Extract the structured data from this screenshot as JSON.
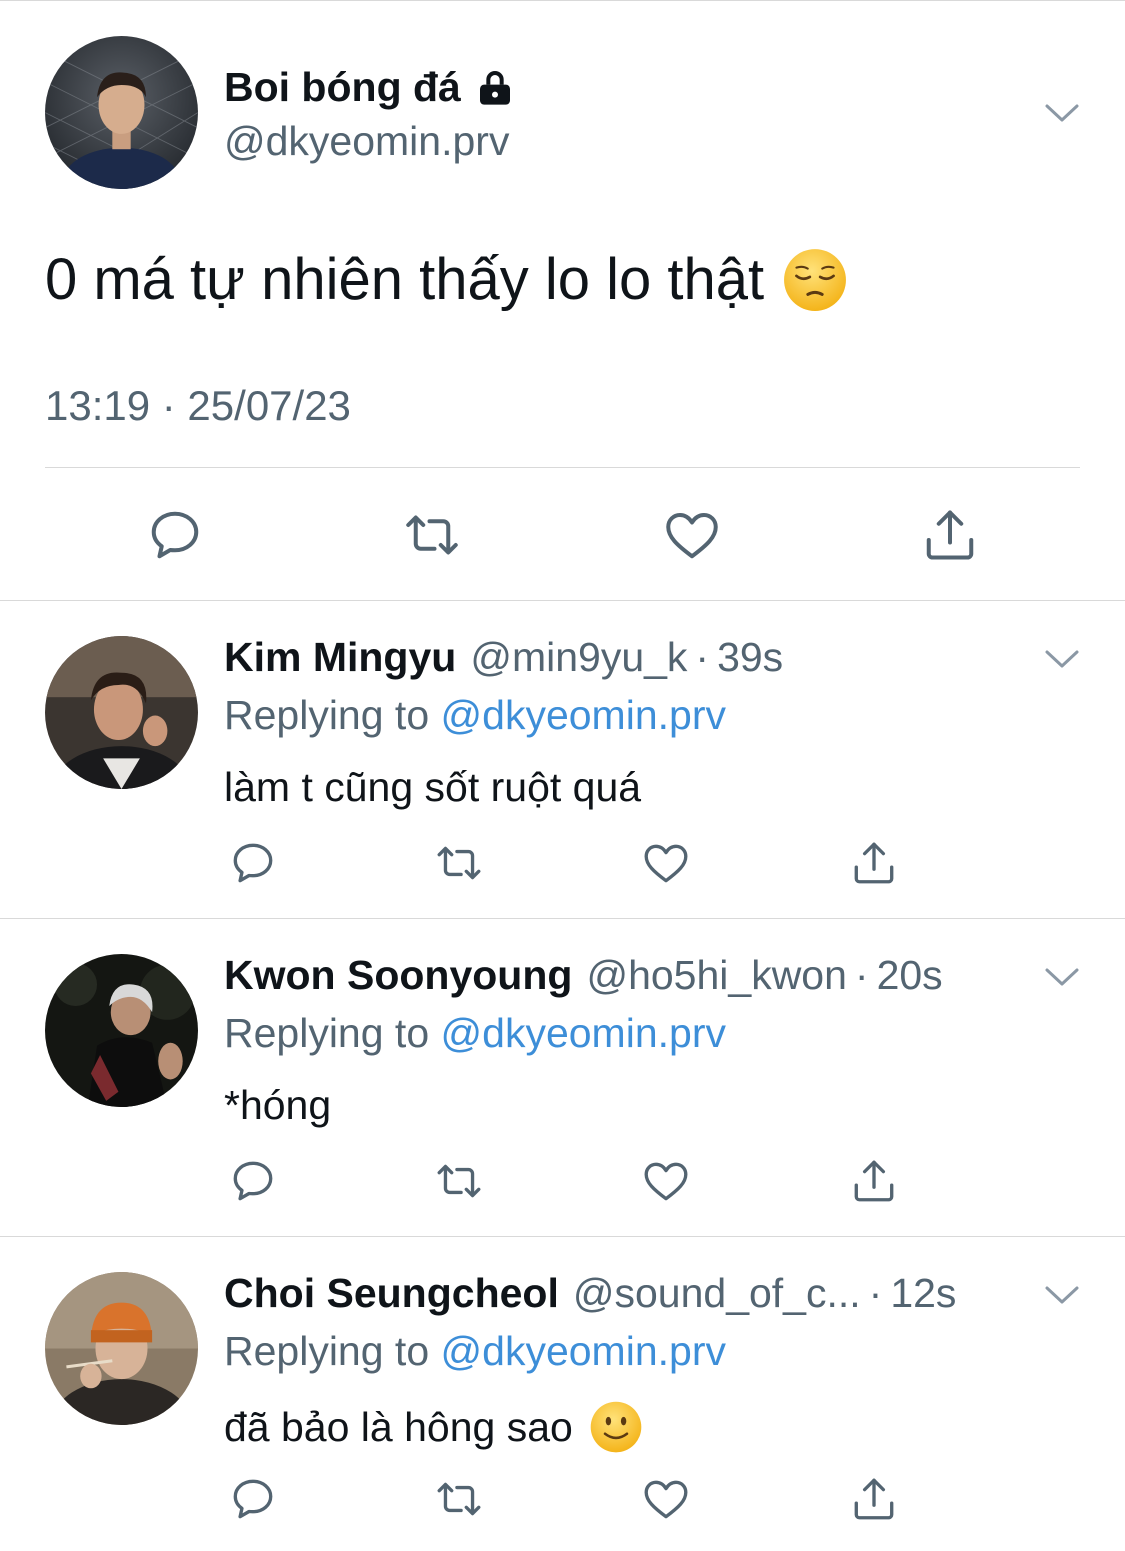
{
  "main": {
    "name": "Boi bóng đá",
    "handle": "@dkyeomin.prv",
    "text": "0 má tự nhiên thấy lo lo thật",
    "emoji": "pensive-face",
    "timestamp": "13:19 · 25/07/23"
  },
  "replying_label": "Replying to",
  "replies": [
    {
      "name": "Kim Mingyu",
      "handle": "@min9yu_k",
      "time": "39s",
      "mention": "@dkyeomin.prv",
      "text": "làm t cũng sốt ruột quá"
    },
    {
      "name": "Kwon Soonyoung",
      "handle": "@ho5hi_kwon",
      "time": "20s",
      "mention": "@dkyeomin.prv",
      "text": "*hóng"
    },
    {
      "name": "Choi Seungcheol",
      "handle": "@sound_of_c...",
      "time": "12s",
      "mention": "@dkyeomin.prv",
      "text": "đã bảo là hông sao",
      "emoji": "slightly-smiling-face"
    }
  ],
  "separator": "·",
  "colors": {
    "text": "#0f1419",
    "secondary": "#536471",
    "mention": "#3d8ed8",
    "icon": "#536471",
    "divider": "#d9d9d9"
  },
  "icons": [
    "lock-icon",
    "chevron-down-icon",
    "reply-icon",
    "retweet-icon",
    "like-icon",
    "share-icon"
  ]
}
